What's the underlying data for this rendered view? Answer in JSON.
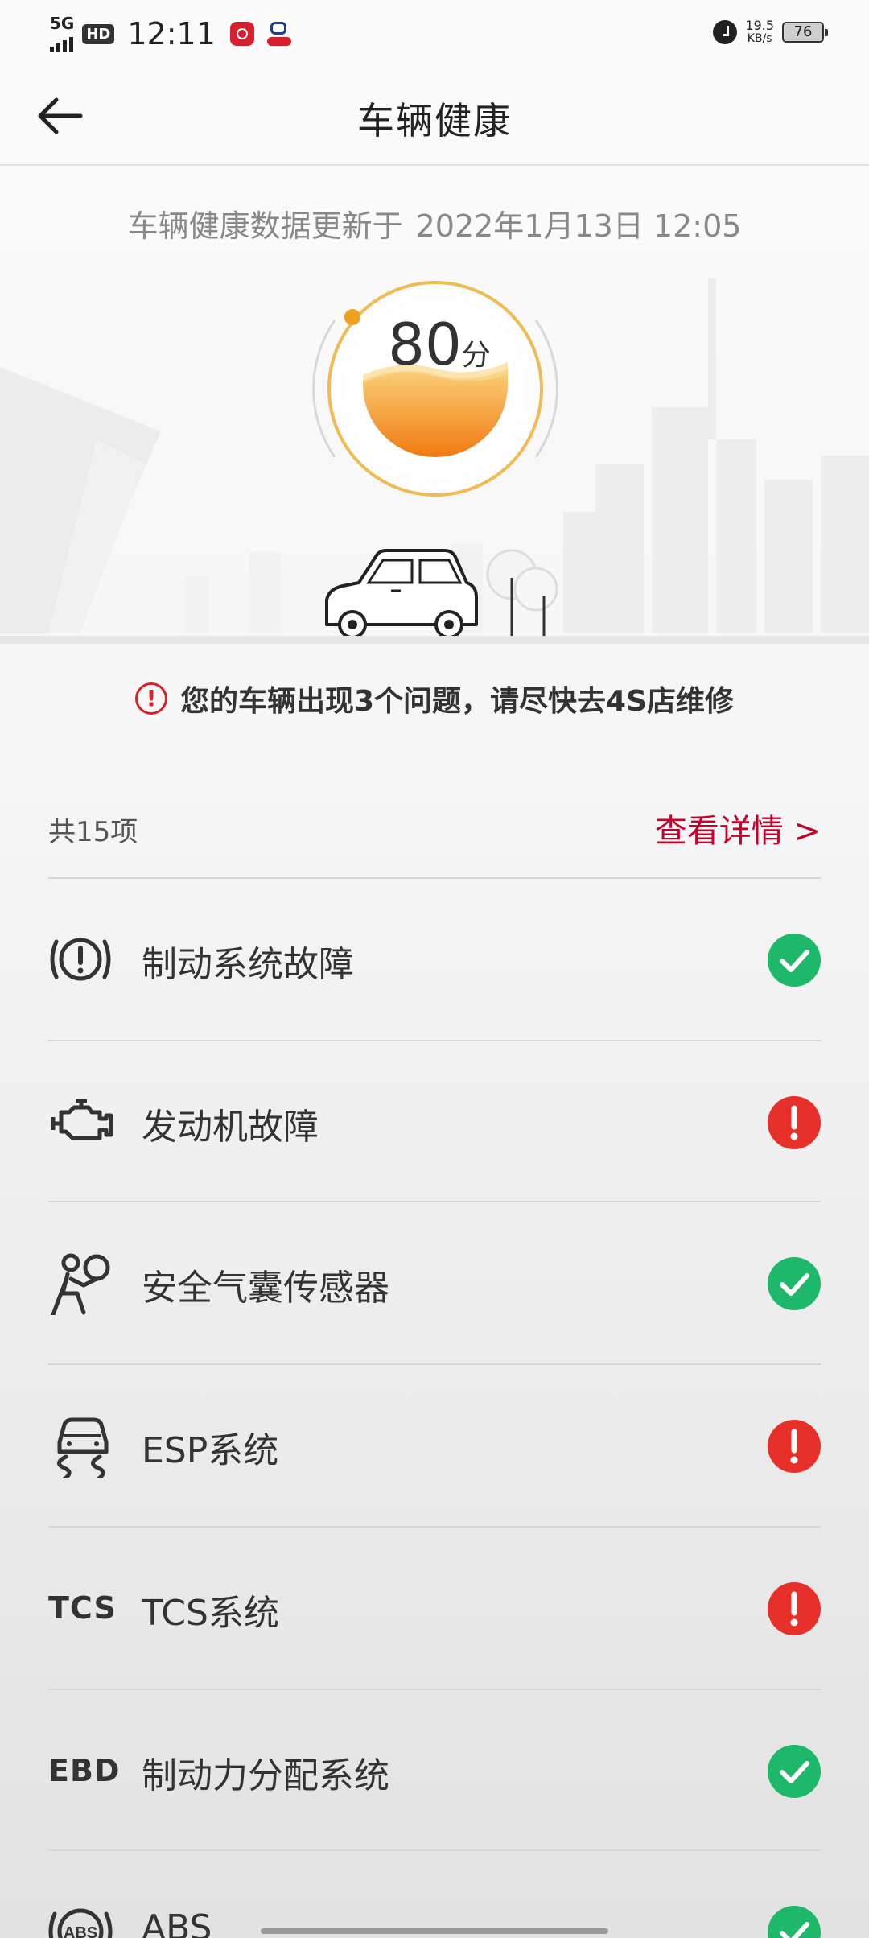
{
  "status_bar": {
    "network": "5G",
    "hd": "HD",
    "time": "12:11",
    "speed": "19.5",
    "speed_unit": "KB/s",
    "battery": "76"
  },
  "nav": {
    "title": "车辆健康"
  },
  "update": {
    "label": "车辆健康数据更新于",
    "datetime": "2022年1月13日 12:05"
  },
  "score": {
    "value": "80",
    "unit": "分"
  },
  "warning": {
    "text": "您的车辆出现3个问题，请尽快去4S店维修"
  },
  "summary": {
    "count": "共15项",
    "details_link": "查看详情 >"
  },
  "items": [
    {
      "label": "制动系统故障",
      "icon": "brake-warning-icon",
      "status": "ok"
    },
    {
      "label": "发动机故障",
      "icon": "engine-icon",
      "status": "error"
    },
    {
      "label": "安全气囊传感器",
      "icon": "airbag-icon",
      "status": "ok"
    },
    {
      "label": "ESP系统",
      "icon": "esp-icon",
      "status": "error"
    },
    {
      "label": "TCS系统",
      "icon": "tcs-icon",
      "icon_text": "TCS",
      "status": "error"
    },
    {
      "label": "制动力分配系统",
      "icon": "ebd-icon",
      "icon_text": "EBD",
      "status": "ok"
    },
    {
      "label": "ABS",
      "icon": "abs-icon",
      "icon_text": "ABS",
      "status": "ok"
    }
  ],
  "colors": {
    "accent_red": "#c7002b",
    "ok_green": "#1db86a",
    "error_red": "#e8302a",
    "gauge_orange": "#f5a623"
  }
}
